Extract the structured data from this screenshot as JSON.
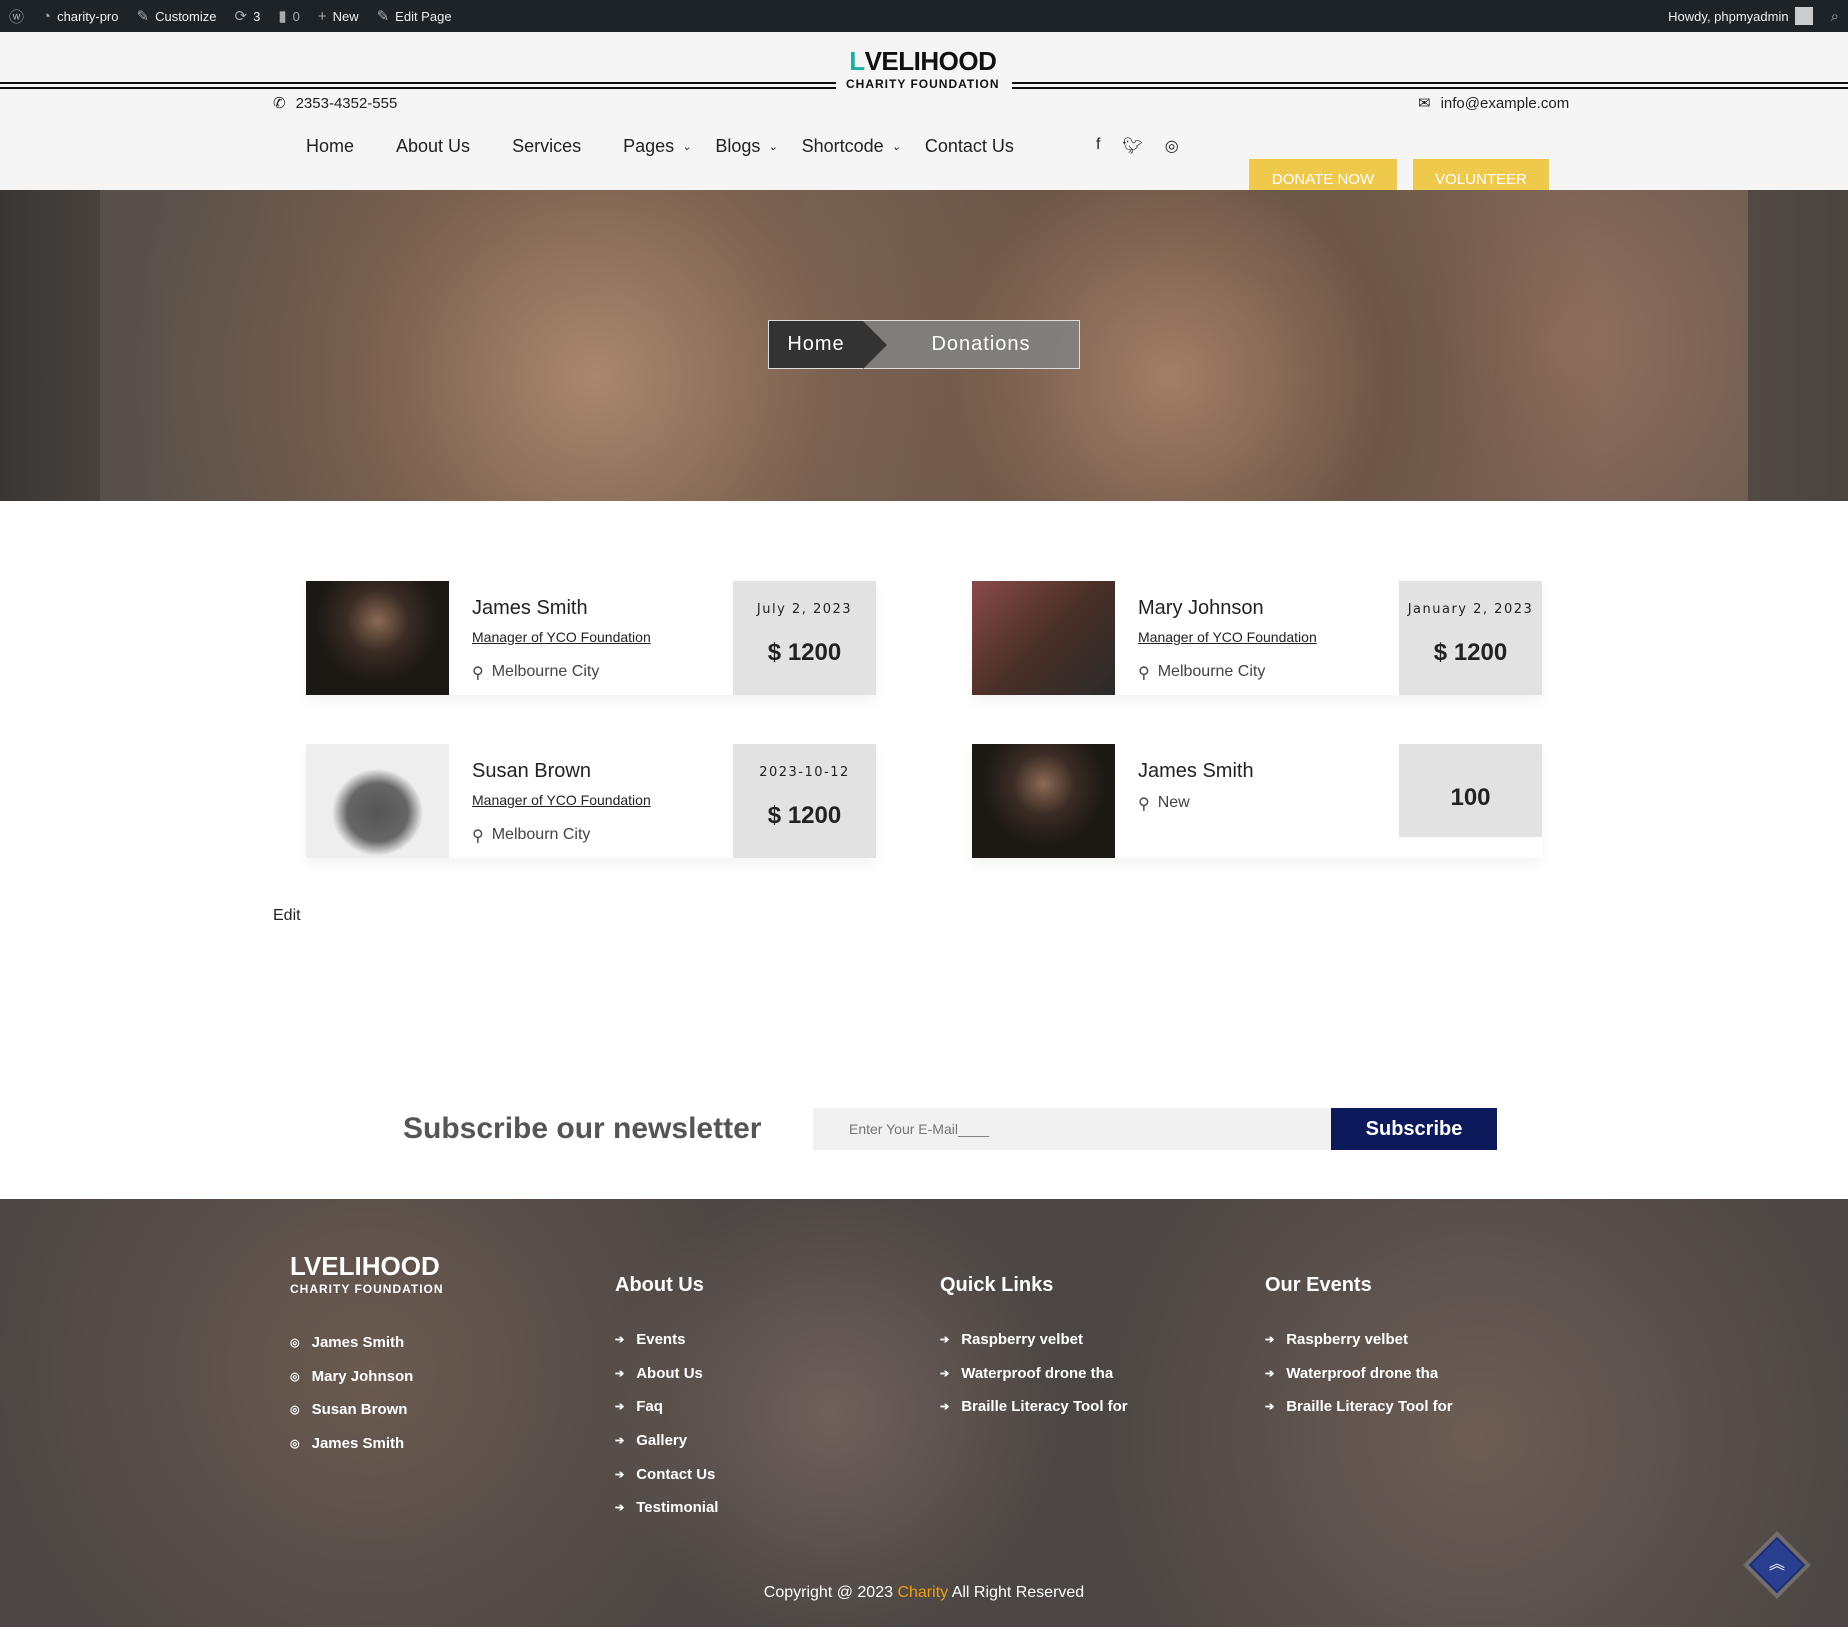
{
  "adminbar": {
    "items": [
      {
        "icon": "wordpress-icon",
        "label": ""
      },
      {
        "icon": "dashboard-icon",
        "label": "charity-pro"
      },
      {
        "icon": "brush-icon",
        "label": "Customize"
      },
      {
        "icon": "updates-icon",
        "label": "3"
      },
      {
        "icon": "comment-icon",
        "label": "0"
      },
      {
        "icon": "plus-icon",
        "label": "New"
      },
      {
        "icon": "pencil-icon",
        "label": "Edit Page"
      }
    ],
    "howdy": "Howdy, phpmyadmin"
  },
  "header": {
    "phone": "2353-4352-555",
    "email": "info@example.com",
    "logo_word": "VELIHOOD",
    "logo_l": "L",
    "logo_sub": "CHARITY FOUNDATION",
    "nav": [
      {
        "label": "Home"
      },
      {
        "label": "About Us"
      },
      {
        "label": "Services"
      },
      {
        "label": "Pages",
        "dropdown": true
      },
      {
        "label": "Blogs",
        "dropdown": true
      },
      {
        "label": "Shortcode",
        "dropdown": true
      },
      {
        "label": "Contact Us"
      }
    ],
    "donate": "DONATE NOW",
    "volunteer": "VOLUNTEER"
  },
  "breadcrumb": {
    "home": "Home",
    "current": "Donations"
  },
  "donations": [
    {
      "name": "James Smith",
      "role": "Manager of YCO Foundation",
      "location": "Melbourne City",
      "date": "July 2, 2023",
      "amount": "$ 1200"
    },
    {
      "name": "Mary Johnson",
      "role": "Manager of YCO Foundation",
      "location": "Melbourne City",
      "date": "January 2, 2023",
      "amount": "$ 1200"
    },
    {
      "name": "Susan Brown",
      "role": "Manager of YCO Foundation",
      "location": "Melbourn City",
      "date": "2023-10-12",
      "amount": "$ 1200"
    },
    {
      "name": "James Smith",
      "role": "",
      "location": "New",
      "date": "",
      "amount": "100"
    }
  ],
  "edit": "Edit",
  "newsletter": {
    "title": "Subscribe our newsletter",
    "placeholder": "Enter Your E-Mail____",
    "button": "Subscribe"
  },
  "footer": {
    "donors": [
      "James Smith",
      "Mary Johnson",
      "Susan Brown",
      "James Smith"
    ],
    "about_title": "About Us",
    "about": [
      "Events",
      "About Us",
      "Faq",
      "Gallery",
      "Contact Us",
      "Testimonial"
    ],
    "quick_title": "Quick Links",
    "quick": [
      "Raspberry velbet",
      "Waterproof drone tha",
      "Braille Literacy Tool for"
    ],
    "events_title": "Our Events",
    "events": [
      "Raspberry velbet",
      "Waterproof drone tha",
      "Braille Literacy Tool for"
    ],
    "copy_pre": "Copyright @ 2023 ",
    "copy_brand": "Charity",
    "copy_post": " All Right Reserved"
  },
  "colors": {
    "accent": "#efc94c",
    "navy": "#0c1a5b",
    "brand_orange": "#f39c12",
    "teal": "#1ab0a4"
  }
}
